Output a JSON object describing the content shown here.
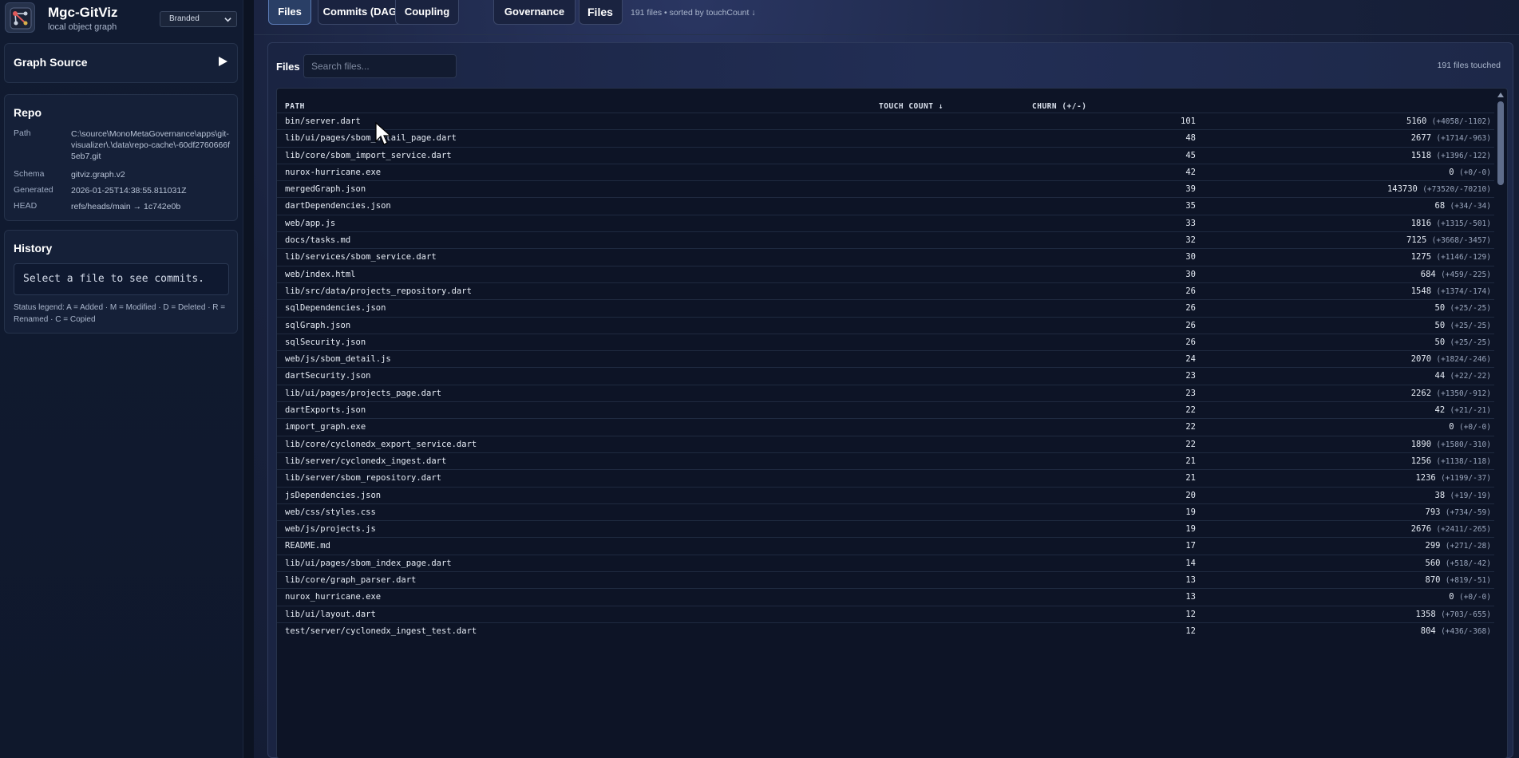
{
  "app": {
    "title": "Mgc-GitViz",
    "subtitle": "local object graph",
    "theme": "Branded"
  },
  "sidebar": {
    "graph_source": {
      "title": "Graph Source"
    },
    "repo": {
      "title": "Repo",
      "path_label": "Path",
      "path": "C:\\source\\MonoMetaGovernance\\apps\\git-visualizer\\.\\data\\repo-cache\\-60df2760666f5eb7.git",
      "schema_label": "Schema",
      "schema": "gitviz.graph.v2",
      "generated_label": "Generated",
      "generated": "2026-01-25T14:38:55.811031Z",
      "head_label": "HEAD",
      "head": "refs/heads/main → 1c742e0b"
    },
    "history": {
      "title": "History",
      "placeholder": "Select a file to see commits.",
      "legend": "Status legend: A = Added · M = Modified · D = Deleted · R = Renamed · C = Copied"
    }
  },
  "tabs": [
    {
      "label": "Files",
      "active": true
    },
    {
      "label": "Commits (DAG)",
      "active": false
    },
    {
      "label": "Coupling",
      "active": false
    },
    {
      "label": "Governance",
      "active": false
    }
  ],
  "context": {
    "label": "Files",
    "meta": "191 files • sorted by touchCount ↓"
  },
  "panel": {
    "title": "Files",
    "search_placeholder": "Search files...",
    "count": "191 files touched"
  },
  "table": {
    "headers": {
      "path": "PATH",
      "touch": "TOUCH COUNT ↓",
      "churn": "CHURN (+/-)"
    },
    "rows": [
      {
        "path": "bin/server.dart",
        "touch": "101",
        "churn": "5160",
        "delta": "(+4058/-1102)"
      },
      {
        "path": "lib/ui/pages/sbom_detail_page.dart",
        "touch": "48",
        "churn": "2677",
        "delta": "(+1714/-963)"
      },
      {
        "path": "lib/core/sbom_import_service.dart",
        "touch": "45",
        "churn": "1518",
        "delta": "(+1396/-122)"
      },
      {
        "path": "nurox-hurricane.exe",
        "touch": "42",
        "churn": "0",
        "delta": "(+0/-0)"
      },
      {
        "path": "mergedGraph.json",
        "touch": "39",
        "churn": "143730",
        "delta": "(+73520/-70210)"
      },
      {
        "path": "dartDependencies.json",
        "touch": "35",
        "churn": "68",
        "delta": "(+34/-34)"
      },
      {
        "path": "web/app.js",
        "touch": "33",
        "churn": "1816",
        "delta": "(+1315/-501)"
      },
      {
        "path": "docs/tasks.md",
        "touch": "32",
        "churn": "7125",
        "delta": "(+3668/-3457)"
      },
      {
        "path": "lib/services/sbom_service.dart",
        "touch": "30",
        "churn": "1275",
        "delta": "(+1146/-129)"
      },
      {
        "path": "web/index.html",
        "touch": "30",
        "churn": "684",
        "delta": "(+459/-225)"
      },
      {
        "path": "lib/src/data/projects_repository.dart",
        "touch": "26",
        "churn": "1548",
        "delta": "(+1374/-174)"
      },
      {
        "path": "sqlDependencies.json",
        "touch": "26",
        "churn": "50",
        "delta": "(+25/-25)"
      },
      {
        "path": "sqlGraph.json",
        "touch": "26",
        "churn": "50",
        "delta": "(+25/-25)"
      },
      {
        "path": "sqlSecurity.json",
        "touch": "26",
        "churn": "50",
        "delta": "(+25/-25)"
      },
      {
        "path": "web/js/sbom_detail.js",
        "touch": "24",
        "churn": "2070",
        "delta": "(+1824/-246)"
      },
      {
        "path": "dartSecurity.json",
        "touch": "23",
        "churn": "44",
        "delta": "(+22/-22)"
      },
      {
        "path": "lib/ui/pages/projects_page.dart",
        "touch": "23",
        "churn": "2262",
        "delta": "(+1350/-912)"
      },
      {
        "path": "dartExports.json",
        "touch": "22",
        "churn": "42",
        "delta": "(+21/-21)"
      },
      {
        "path": "import_graph.exe",
        "touch": "22",
        "churn": "0",
        "delta": "(+0/-0)"
      },
      {
        "path": "lib/core/cyclonedx_export_service.dart",
        "touch": "22",
        "churn": "1890",
        "delta": "(+1580/-310)"
      },
      {
        "path": "lib/server/cyclonedx_ingest.dart",
        "touch": "21",
        "churn": "1256",
        "delta": "(+1138/-118)"
      },
      {
        "path": "lib/server/sbom_repository.dart",
        "touch": "21",
        "churn": "1236",
        "delta": "(+1199/-37)"
      },
      {
        "path": "jsDependencies.json",
        "touch": "20",
        "churn": "38",
        "delta": "(+19/-19)"
      },
      {
        "path": "web/css/styles.css",
        "touch": "19",
        "churn": "793",
        "delta": "(+734/-59)"
      },
      {
        "path": "web/js/projects.js",
        "touch": "19",
        "churn": "2676",
        "delta": "(+2411/-265)"
      },
      {
        "path": "README.md",
        "touch": "17",
        "churn": "299",
        "delta": "(+271/-28)"
      },
      {
        "path": "lib/ui/pages/sbom_index_page.dart",
        "touch": "14",
        "churn": "560",
        "delta": "(+518/-42)"
      },
      {
        "path": "lib/core/graph_parser.dart",
        "touch": "13",
        "churn": "870",
        "delta": "(+819/-51)"
      },
      {
        "path": "nurox_hurricane.exe",
        "touch": "13",
        "churn": "0",
        "delta": "(+0/-0)"
      },
      {
        "path": "lib/ui/layout.dart",
        "touch": "12",
        "churn": "1358",
        "delta": "(+703/-655)"
      },
      {
        "path": "test/server/cyclonedx_ingest_test.dart",
        "touch": "12",
        "churn": "804",
        "delta": "(+436/-368)"
      }
    ]
  },
  "icons": {
    "logo": "graph-logo-icon",
    "theme_chevron": "chevron-down-icon",
    "graph_source_toggle": "play-icon",
    "scroll_up": "caret-up-icon",
    "cursor": "mouse-pointer-icon"
  },
  "colors": {
    "accent": "#5b7bb5",
    "background": "#0e1628",
    "panel": "#152038"
  }
}
